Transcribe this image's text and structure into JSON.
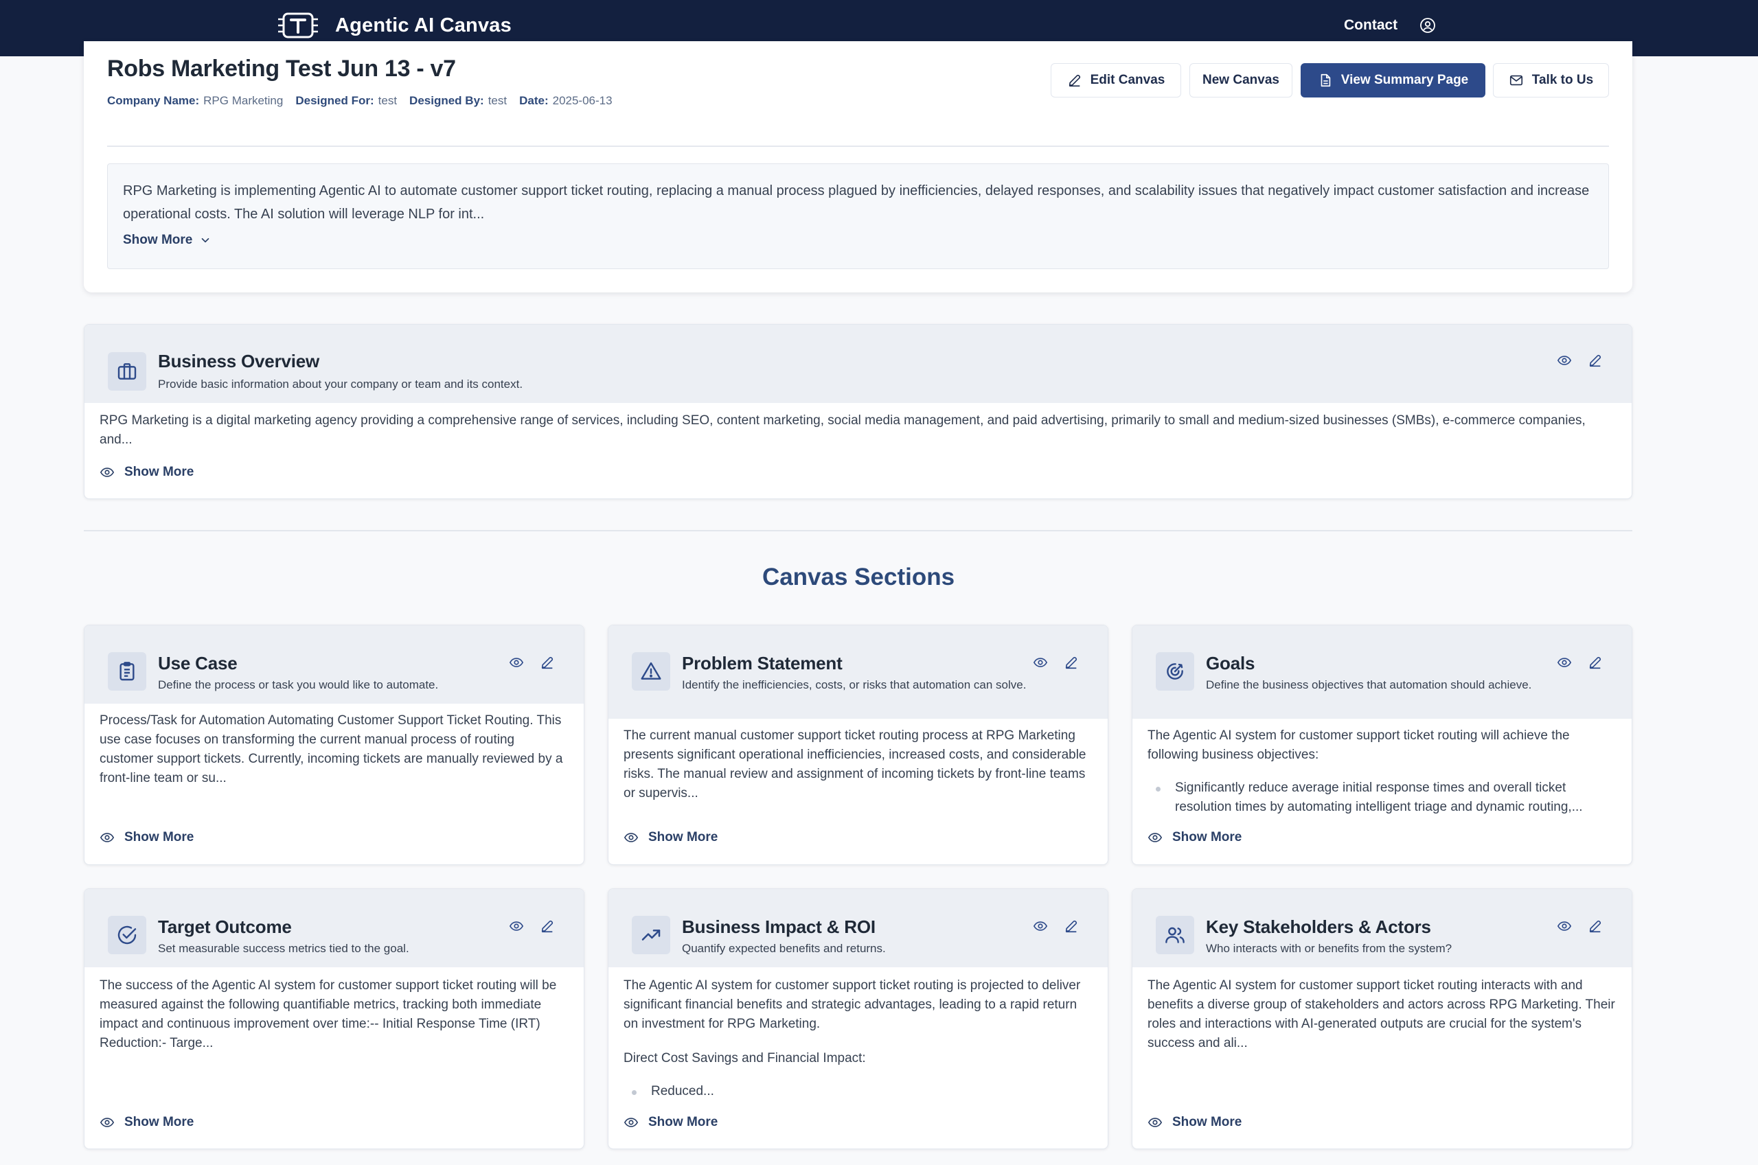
{
  "app": {
    "title": "Agentic AI Canvas",
    "logo_icon": "T-circuit-logo-icon",
    "nav": {
      "contact_label": "Contact",
      "account_icon": "user-circle-icon"
    }
  },
  "canvas": {
    "title": "Robs Marketing Test Jun 13 - v7",
    "meta": {
      "company_label": "Company Name:",
      "company_value": "RPG Marketing",
      "designed_for_label": "Designed For:",
      "designed_for_value": "test",
      "designed_by_label": "Designed By:",
      "designed_by_value": "test",
      "date_label": "Date:",
      "date_value": "2025-06-13"
    },
    "actions": {
      "edit": "Edit Canvas",
      "new": "New Canvas",
      "summary": "View Summary Page",
      "talk": "Talk to Us"
    },
    "summary": {
      "text": "RPG Marketing is implementing Agentic AI to automate customer support ticket routing, replacing a manual process plagued by inefficiencies, delayed responses, and scalability issues that negatively impact customer satisfaction and increase operational costs. The AI solution will leverage NLP for int...",
      "show_more": "Show More"
    }
  },
  "business_overview": {
    "title": "Business Overview",
    "subtitle": "Provide basic information about your company or team and its context.",
    "icon": "briefcase-icon",
    "body": "RPG Marketing is a digital marketing agency providing a comprehensive range of services, including SEO, content marketing, social media management, and paid advertising, primarily to small and medium-sized businesses (SMBs), e-commerce companies, and...",
    "show_more": "Show More"
  },
  "sections_heading": "Canvas Sections",
  "sections": [
    {
      "title": "Use Case",
      "subtitle": "Define the process or task you would like to automate.",
      "icon": "clipboard-list-icon",
      "body": "Process/Task for Automation Automating Customer Support Ticket Routing. This use case focuses on transforming the current manual process of routing customer support tickets. Currently, incoming tickets are manually reviewed by a front-line team or su...",
      "show_more": "Show More"
    },
    {
      "title": "Problem Statement",
      "subtitle": "Identify the inefficiencies, costs, or risks that automation can solve.",
      "icon": "warning-triangle-icon",
      "body": "The current manual customer support ticket routing process at RPG Marketing presents significant operational inefficiencies, increased costs, and considerable risks. The manual review and assignment of incoming tickets by front-line teams or supervis...",
      "show_more": "Show More"
    },
    {
      "title": "Goals",
      "subtitle": "Define the business objectives that automation should achieve.",
      "icon": "target-goal-icon",
      "body": "The Agentic AI system for customer support ticket routing will achieve the following business objectives:",
      "bullet": "Significantly reduce average initial response times and overall ticket resolution times by automating intelligent triage and dynamic routing,...",
      "show_more": "Show More"
    },
    {
      "title": "Target Outcome",
      "subtitle": "Set measurable success metrics tied to the goal.",
      "icon": "check-circle-icon",
      "body": "The success of the Agentic AI system for customer support ticket routing will be measured against the following quantifiable metrics, tracking both immediate impact and continuous improvement over time:-- Initial Response Time (IRT) Reduction:- Targe...",
      "show_more": "Show More"
    },
    {
      "title": "Business Impact & ROI",
      "subtitle": "Quantify expected benefits and returns.",
      "icon": "trending-up-icon",
      "body": "The Agentic AI system for customer support ticket routing is projected to deliver significant financial benefits and strategic advantages, leading to a rapid return on investment for RPG Marketing.",
      "body2": "Direct Cost Savings and Financial Impact:",
      "bullet": "Reduced...",
      "show_more": "Show More"
    },
    {
      "title": "Key Stakeholders & Actors",
      "subtitle": "Who interacts with or benefits from the system?",
      "icon": "users-icon",
      "body": "The Agentic AI system for customer support ticket routing interacts with and benefits a diverse group of stakeholders and actors across RPG Marketing. Their roles and interactions with AI-generated outputs are crucial for the system's success and ali...",
      "show_more": "Show More"
    }
  ],
  "colors": {
    "nav_bg": "#13203f",
    "primary": "#2d4a8a",
    "heading": "#2d4a7a"
  }
}
